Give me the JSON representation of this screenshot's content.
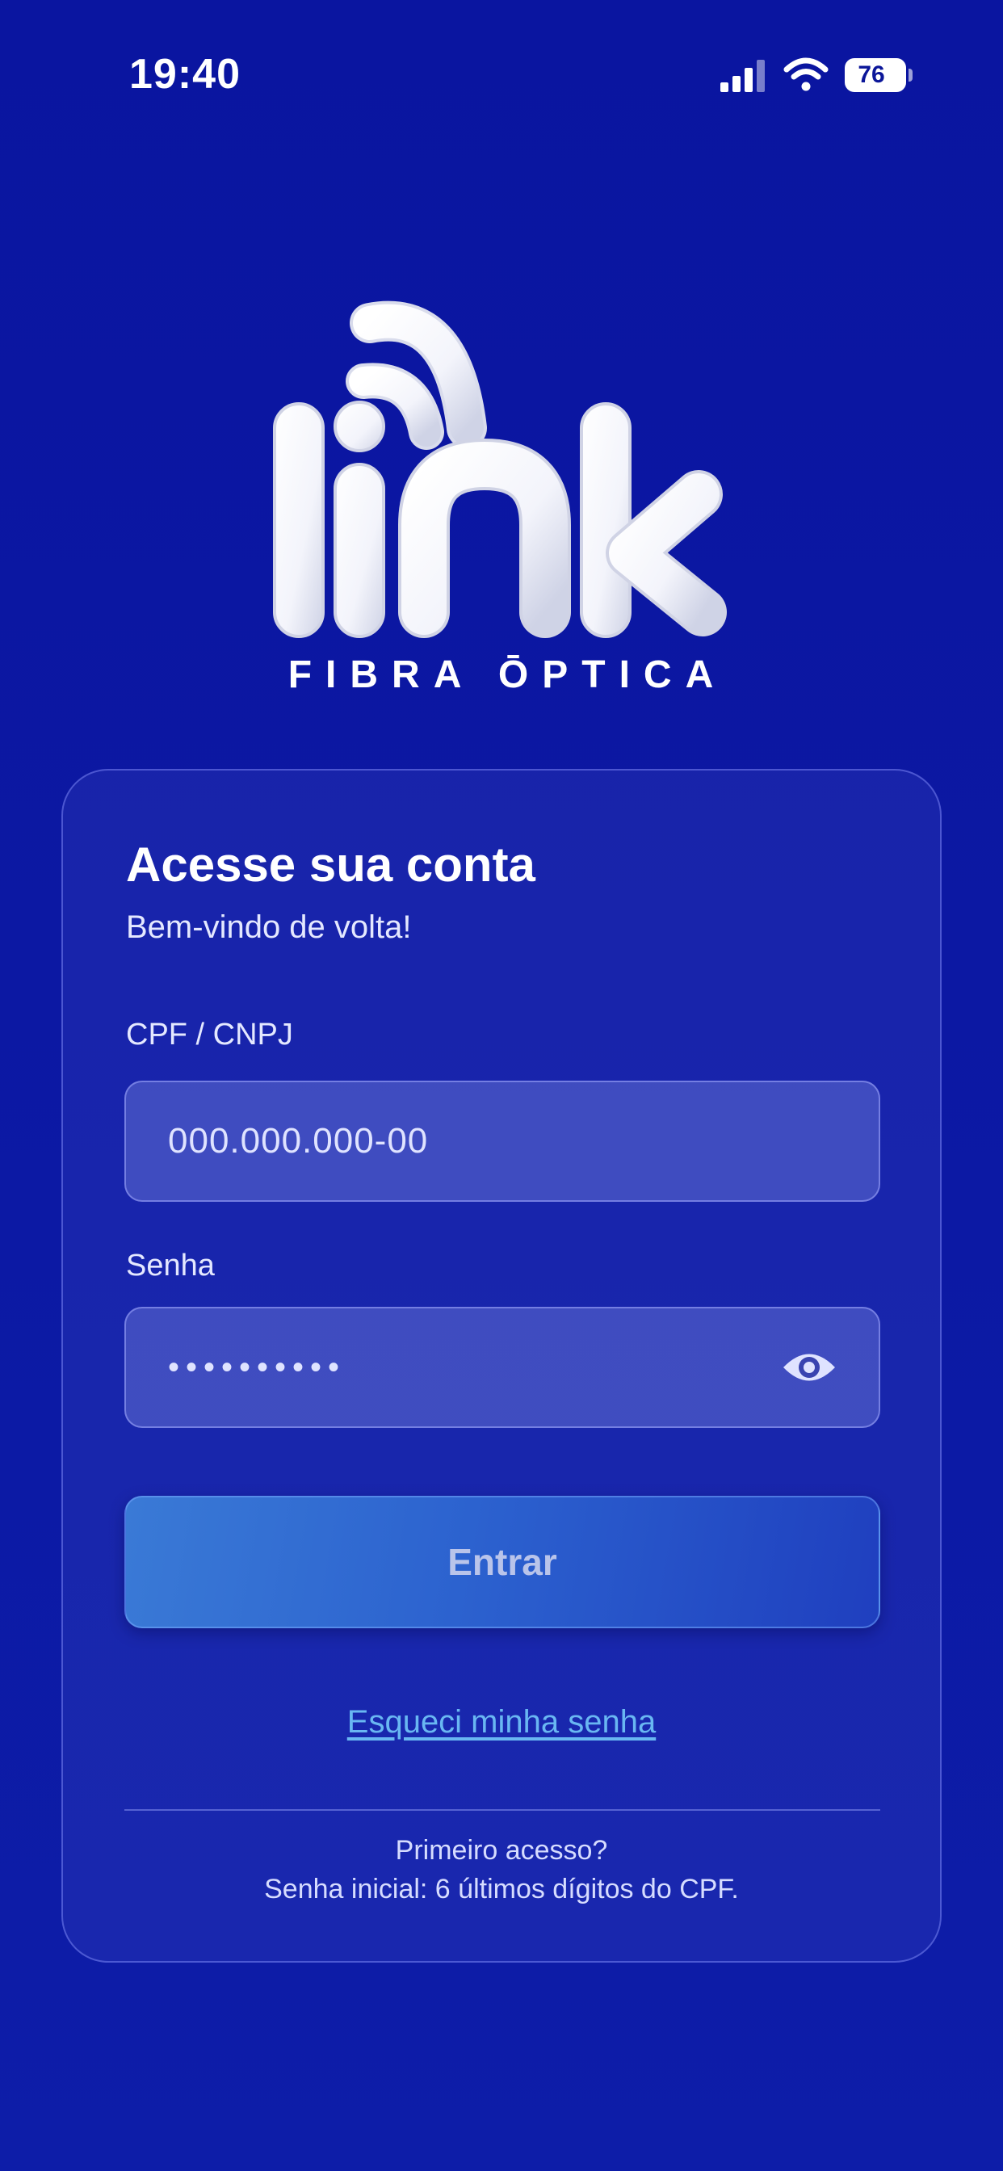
{
  "status_bar": {
    "time": "19:40",
    "battery_level": "76",
    "icons": [
      "cellular-signal-icon",
      "wifi-icon",
      "battery-icon"
    ]
  },
  "brand": {
    "logo_text": "link",
    "tagline": "FIBRA ŌPTICA"
  },
  "login": {
    "title": "Acesse sua conta",
    "subtitle": "Bem-vindo de volta!",
    "cpf_label": "CPF / CNPJ",
    "cpf_placeholder": "000.000.000-00",
    "password_label": "Senha",
    "password_value": "••••••••••",
    "show_password_icon": "eye-icon",
    "submit_label": "Entrar",
    "forgot_link": "Esqueci minha senha",
    "first_access_title": "Primeiro acesso?",
    "first_access_hint": "Senha inicial: 6 últimos dígitos do CPF."
  },
  "colors": {
    "background": "#0c18a3",
    "link": "#69b7f2",
    "button_start": "#3a7ad6",
    "button_end": "#1f3fbf"
  }
}
